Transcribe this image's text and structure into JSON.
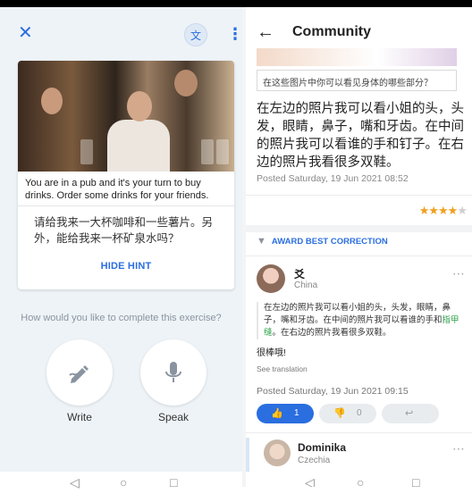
{
  "left": {
    "translate_label": "文",
    "task_text": "You are in a pub and it's your turn to buy drinks. Order some drinks for your friends.",
    "hint_text": "请给我来一大杯咖啡和一些薯片。另外，能给我来一杯矿泉水吗？",
    "hide_hint_label": "HIDE HINT",
    "question": "How would you like to complete this exercise?",
    "write_label": "Write",
    "speak_label": "Speak"
  },
  "right": {
    "title": "Community",
    "quote": "在这些图片中你可以看见身体的哪些部分？",
    "main_text": "在左边的照片我可以看小姐的头，头发，眼睛，鼻子，嘴和牙齿。在中间的照片我可以看谁的手和钉子。在右边的照片我看很多双鞋。",
    "posted1": "Posted Saturday, 19 Jun 2021 08:52",
    "rating": 4,
    "award_label": "AWARD BEST CORRECTION",
    "user1": {
      "name": "爻",
      "country": "China"
    },
    "correction_before": "在左边的照片我可以看小姐的头，头发，眼睛，鼻子，嘴和牙齿。在中间的照片我可以看谁的手和",
    "correction_highlight": "指甲缝",
    "correction_after": "。在右边的照片我看很多双鞋。",
    "comment": "很棒哦!",
    "see_translation": "See translation",
    "posted2": "Posted Saturday, 19 Jun 2021 09:15",
    "likes": "1",
    "dislikes": "0",
    "user2": {
      "name": "Dominika",
      "country": "Czechia"
    }
  },
  "colors": {
    "accent": "#2a6ee0",
    "star": "#f0a020",
    "highlight": "#2fa24b"
  }
}
